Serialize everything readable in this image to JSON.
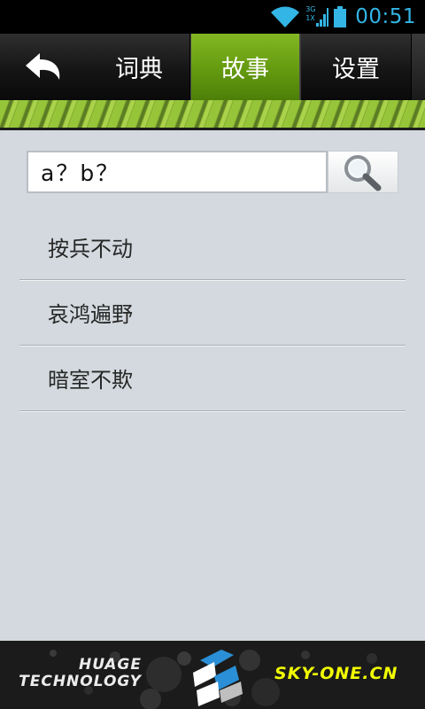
{
  "status_bar": {
    "time": "00:51",
    "network_top": "3G",
    "network_bottom": "1X",
    "icons": [
      "wifi-icon",
      "signal-icon",
      "battery-icon"
    ],
    "accent_color": "#33b5e5"
  },
  "top_bar": {
    "back_icon": "undo-arrow-icon",
    "tabs": [
      {
        "label": "词典",
        "active": false
      },
      {
        "label": "故事",
        "active": true
      },
      {
        "label": "设置",
        "active": false
      }
    ],
    "active_color": "#6aa014"
  },
  "search": {
    "value": "a？b？",
    "button_icon": "search-icon"
  },
  "results": [
    {
      "label": "按兵不动"
    },
    {
      "label": "哀鸿遍野"
    },
    {
      "label": "暗室不欺"
    }
  ],
  "footer": {
    "brand_line1": "HUAGE",
    "brand_line2": "TECHNOLOGY",
    "url": "SKY-ONE.CN",
    "url_color": "#f2ff00"
  }
}
